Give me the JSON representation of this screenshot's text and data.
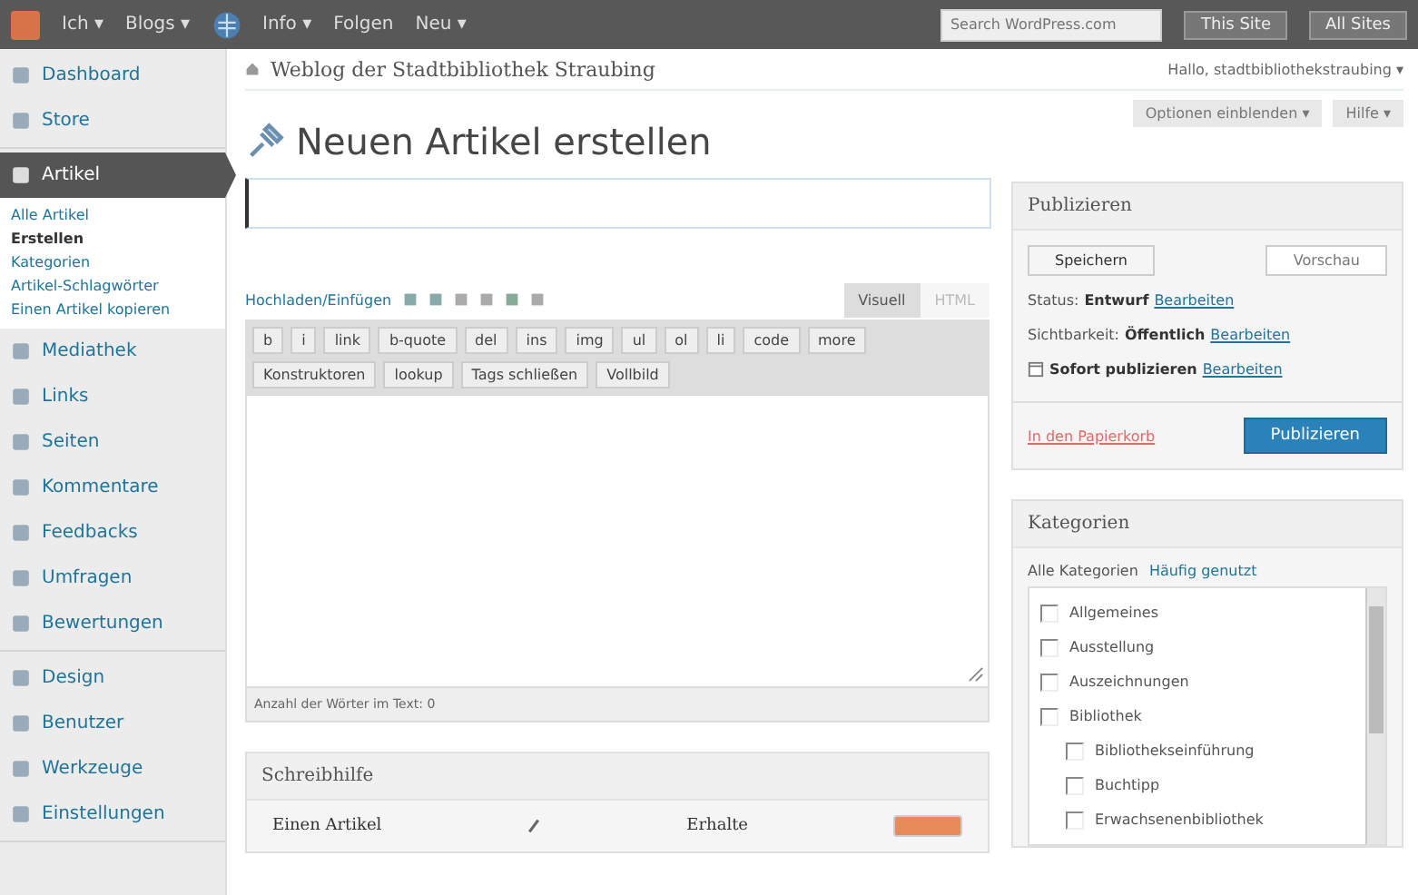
{
  "admin_bar": {
    "items": [
      {
        "label": "Ich ▾"
      },
      {
        "label": "Blogs ▾"
      },
      {
        "label": "Info ▾"
      },
      {
        "label": "Folgen"
      },
      {
        "label": "Neu ▾"
      }
    ],
    "search": {
      "placeholder": "Search WordPress.com"
    },
    "buttons": [
      "This Site",
      "All Sites"
    ]
  },
  "site_header": {
    "site_title": "Weblog der Stadtbibliothek Straubing",
    "greeting": "Hallo, stadtbibliothekstraubing ▾"
  },
  "screen_buttons": [
    "Optionen einblenden ▾",
    "Hilfe ▾"
  ],
  "sidebar": {
    "groups": [
      [
        {
          "label": "Dashboard",
          "selected": false
        },
        {
          "label": "Store",
          "selected": false
        }
      ],
      [
        {
          "label": "Artikel",
          "selected": true,
          "children": [
            {
              "label": "Alle Artikel",
              "selected": false
            },
            {
              "label": "Erstellen",
              "selected": true
            },
            {
              "label": "Kategorien",
              "selected": false
            },
            {
              "label": "Artikel-Schlagwörter",
              "selected": false
            },
            {
              "label": "Einen Artikel kopieren",
              "selected": false
            }
          ]
        },
        {
          "label": "Mediathek",
          "selected": false
        },
        {
          "label": "Links",
          "selected": false
        },
        {
          "label": "Seiten",
          "selected": false
        },
        {
          "label": "Kommentare",
          "selected": false
        },
        {
          "label": "Feedbacks",
          "selected": false
        },
        {
          "label": "Umfragen",
          "selected": false
        },
        {
          "label": "Bewertungen",
          "selected": false
        }
      ],
      [
        {
          "label": "Design",
          "selected": false
        },
        {
          "label": "Benutzer",
          "selected": false
        },
        {
          "label": "Werkzeuge",
          "selected": false
        },
        {
          "label": "Einstellungen",
          "selected": false
        }
      ]
    ]
  },
  "page_title": "Neuen Artikel erstellen",
  "editor": {
    "upload_label": "Hochladen/Einfügen",
    "tabs": [
      {
        "label": "Visuell",
        "selected": true
      },
      {
        "label": "HTML",
        "selected": false
      }
    ],
    "quicktags": [
      "b",
      "i",
      "link",
      "b-quote",
      "del",
      "ins",
      "img",
      "ul",
      "ol",
      "li",
      "code",
      "more",
      "Konstruktoren",
      "lookup",
      "Tags schließen",
      "Vollbild"
    ],
    "word_count": "Anzahl der Wörter im Text: 0"
  },
  "writing_help": {
    "title": "Schreibhilfe",
    "texts": [
      "Einen Artikel",
      "Erhalte"
    ]
  },
  "publish": {
    "title": "Publizieren",
    "save_button": "Speichern",
    "preview_button": "Vorschau",
    "rows": [
      {
        "label": "Status:",
        "value": "Entwurf",
        "link": "Bearbeiten",
        "kind": "text"
      },
      {
        "label": "Sichtbarkeit:",
        "value": "Öffentlich",
        "link": "Bearbeiten",
        "kind": "text"
      },
      {
        "label": "",
        "value": "Sofort publizieren",
        "link": "Bearbeiten",
        "kind": "calendar"
      }
    ],
    "trash_link": "In den Papierkorb",
    "publish_button": "Publizieren"
  },
  "categories": {
    "title": "Kategorien",
    "tabs": [
      {
        "label": "Alle Kategorien",
        "selected": true
      },
      {
        "label": "Häufig genutzt",
        "selected": false
      }
    ],
    "items": [
      {
        "label": "Allgemeines",
        "checked": false
      },
      {
        "label": "Ausstellung",
        "checked": false
      },
      {
        "label": "Auszeichnungen",
        "checked": false
      },
      {
        "label": "Bibliothek",
        "checked": false,
        "children": [
          {
            "label": "Bibliothekseinführung",
            "checked": false
          },
          {
            "label": "Buchtipp",
            "checked": false
          },
          {
            "label": "Erwachsenenbibliothek",
            "checked": false
          }
        ]
      }
    ]
  }
}
